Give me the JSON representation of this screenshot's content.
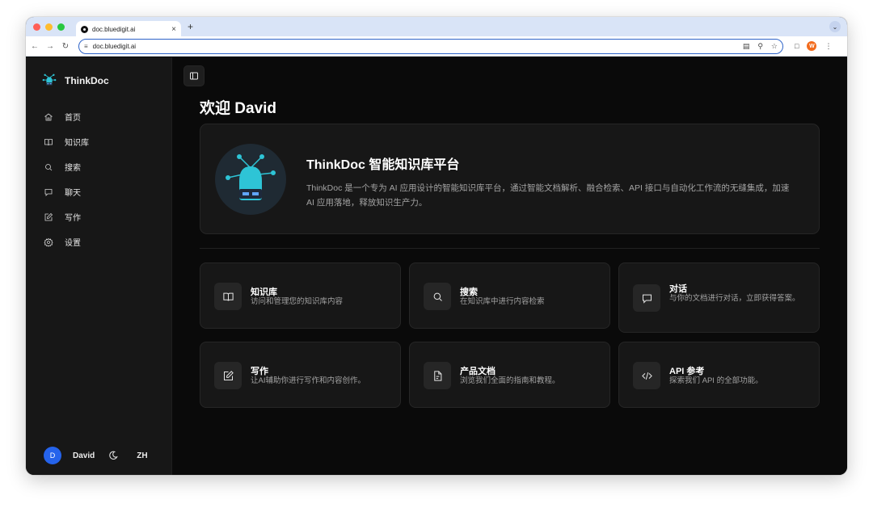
{
  "browser": {
    "tab_title": "doc.bluedigit.ai",
    "tab_close": "×",
    "new_tab": "+",
    "url": "doc.bluedigit.ai",
    "profile_initial": "W"
  },
  "sidebar": {
    "brand": "ThinkDoc",
    "items": [
      {
        "label": "首页",
        "icon": "home-icon"
      },
      {
        "label": "知识库",
        "icon": "book-icon"
      },
      {
        "label": "搜索",
        "icon": "search-icon"
      },
      {
        "label": "聊天",
        "icon": "chat-icon"
      },
      {
        "label": "写作",
        "icon": "pencil-square-icon"
      },
      {
        "label": "设置",
        "icon": "gear-icon"
      }
    ],
    "user_initial": "D",
    "user_name": "David",
    "language": "ZH"
  },
  "main": {
    "title": "欢迎 David",
    "hero": {
      "title": "ThinkDoc 智能知识库平台",
      "description": "ThinkDoc 是一个专为 AI 应用设计的智能知识库平台，通过智能文档解析、融合检索、API 接口与自动化工作流的无缝集成，加速 AI 应用落地，释放知识生产力。"
    },
    "cards": [
      {
        "title": "知识库",
        "desc": "访问和管理您的知识库内容",
        "icon": "book-icon"
      },
      {
        "title": "搜索",
        "desc": "在知识库中进行内容检索",
        "icon": "search-icon"
      },
      {
        "title": "对话",
        "desc": "与你的文档进行对话，立即获得答案。",
        "icon": "chat-icon"
      },
      {
        "title": "写作",
        "desc": "让AI辅助你进行写作和内容创作。",
        "icon": "pencil-square-icon"
      },
      {
        "title": "产品文档",
        "desc": "浏览我们全面的指南和教程。",
        "icon": "document-icon"
      },
      {
        "title": "API 参考",
        "desc": "探索我们 API 的全部功能。",
        "icon": "code-icon"
      }
    ]
  },
  "colors": {
    "background": "#0a0a0a",
    "sidebar": "#171717",
    "card": "#171717",
    "avatar": "#2563eb",
    "robot_accent": "#2ec4d6"
  }
}
